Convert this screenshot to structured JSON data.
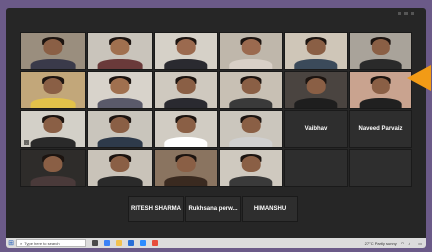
{
  "participants": [
    {
      "name": "",
      "style": "warm"
    },
    {
      "name": "",
      "style": "light"
    },
    {
      "name": "",
      "style": "light"
    },
    {
      "name": "",
      "style": "light"
    },
    {
      "name": "",
      "style": "light"
    },
    {
      "name": "",
      "style": "light"
    },
    {
      "name": "",
      "style": "warm"
    },
    {
      "name": "",
      "style": "light"
    },
    {
      "name": "",
      "style": "light"
    },
    {
      "name": "",
      "style": "light"
    },
    {
      "name": "",
      "style": "dark"
    },
    {
      "name": "",
      "style": "warm"
    },
    {
      "name": "",
      "style": "light"
    },
    {
      "name": "",
      "style": "dark"
    },
    {
      "name": "",
      "style": "light"
    },
    {
      "name": "",
      "style": "light"
    },
    {
      "name": "",
      "style": "dark"
    },
    {
      "name": "",
      "style": "dark"
    },
    {
      "name": "",
      "style": "light"
    },
    {
      "name": "",
      "style": "light"
    },
    {
      "name": "",
      "style": "dark"
    },
    {
      "name": "",
      "style": "dark"
    },
    {
      "name": "",
      "style": "dark"
    },
    {
      "name": "",
      "style": "dark"
    },
    {
      "name": "",
      "style": "light"
    },
    {
      "name": "",
      "style": "dark"
    },
    {
      "name": "",
      "style": "dark"
    }
  ],
  "name_tiles": [
    "Vaibhav",
    "Naveed Parvaiz",
    "RITESH SHARMA",
    "Rukhsana perw...",
    "HIMANSHU"
  ],
  "taskbar": {
    "search_placeholder": "Type here to search",
    "tray_text": "27°C  Partly sunny",
    "clock": ""
  },
  "colors": {
    "wallpaper": "#6b5a88",
    "arrow": "#f29b16",
    "taskbar": "#dcdcdc"
  }
}
